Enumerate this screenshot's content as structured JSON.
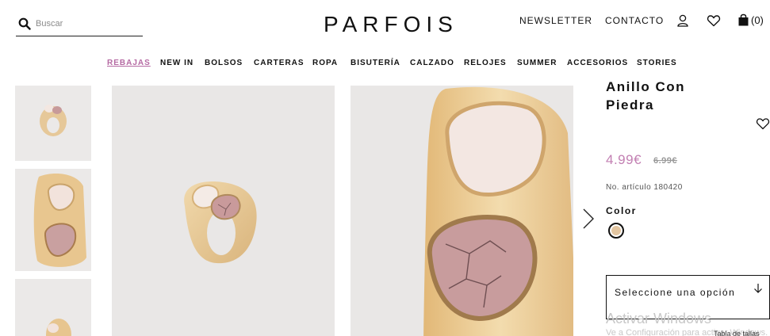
{
  "header": {
    "logo": "PARFOIS",
    "search_placeholder": "Buscar",
    "newsletter": "NEWSLETTER",
    "contacto": "CONTACTO",
    "cart_count": "(0)"
  },
  "nav": {
    "items": [
      "REBAJAS",
      "NEW IN",
      "BOLSOS",
      "CARTERAS",
      "ROPA",
      "BISUTERÍA",
      "CALZADO",
      "RELOJES",
      "SUMMER",
      "ACCESORIOS",
      "STORIES"
    ]
  },
  "product": {
    "title": "Anillo Con Piedra",
    "price": "4.99€",
    "old_price": "6.99€",
    "reference": "No. artículo 180420",
    "color_label": "Color",
    "swatch_color": "#e3c6a1",
    "size_select": "Seleccione una opción"
  },
  "overlay": {
    "watermark_title": "Activar Windows",
    "watermark_sub": "Ve a Configuración para activar Windows.",
    "size_guide": "Tabla de tallas"
  },
  "colors": {
    "sale": "#b56aa3",
    "price": "#c27fb2",
    "image_bg": "#e9e7e6"
  }
}
